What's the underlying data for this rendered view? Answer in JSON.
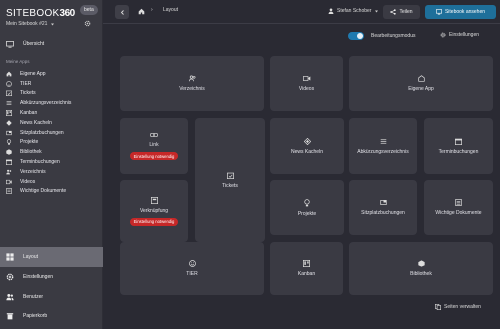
{
  "app": {
    "logo_text": "SITEBOOK",
    "logo_num": "360",
    "beta": "beta",
    "site": "Mein Sitebook #21"
  },
  "sidebar": {
    "overview": "Übersicht",
    "section": "Meine Apps",
    "items": [
      {
        "label": "Eigene App",
        "icon": "home-icon"
      },
      {
        "label": "TIER",
        "icon": "smile-icon"
      },
      {
        "label": "Tickets",
        "icon": "calendar-check-icon"
      },
      {
        "label": "Abkürzungsverzeichnis",
        "icon": "list-icon"
      },
      {
        "label": "Kanban",
        "icon": "kanban-icon"
      },
      {
        "label": "News Kacheln",
        "icon": "diamond-icon"
      },
      {
        "label": "Sitzplatzbuchungen",
        "icon": "seat-icon"
      },
      {
        "label": "Projekte",
        "icon": "bulb-icon"
      },
      {
        "label": "Bibliothek",
        "icon": "library-icon"
      },
      {
        "label": "Terminbuchungen",
        "icon": "calendar-icon"
      },
      {
        "label": "Verzeichnis",
        "icon": "users-icon"
      },
      {
        "label": "Videos",
        "icon": "video-icon"
      },
      {
        "label": "Wichtige Dokumente",
        "icon": "document-icon"
      }
    ],
    "bottom": [
      {
        "label": "Layout",
        "icon": "layout-icon",
        "active": true
      },
      {
        "label": "Einstellungen",
        "icon": "gear-icon"
      },
      {
        "label": "Benutzer",
        "icon": "users-icon"
      },
      {
        "label": "Papierkorb",
        "icon": "trash-icon"
      }
    ]
  },
  "topbar": {
    "breadcrumb": "Layout",
    "user": "Stefan Schober",
    "share": "Teilen",
    "view": "Sitebook ansehen"
  },
  "toolbar": {
    "edit_mode": "Bearbeitungsmodus",
    "settings": "Einstellungen",
    "edit_on": true
  },
  "tiles": {
    "verzeichnis": "Verzeichnis",
    "videos": "Videos",
    "eigene_app": "Eigene App",
    "link": "Link",
    "link_badge": "Einstellung notwendig",
    "tickets": "Tickets",
    "news": "News Kacheln",
    "abk": "Abkürzungsverzeichnis",
    "termin": "Terminbuchungen",
    "verknuepfung": "Verknüpfung",
    "verknuepfung_badge": "Einstellung notwendig",
    "projekte": "Projekte",
    "sitzplatz": "Sitzplatzbuchungen",
    "wichtige": "Wichtige Dokumente",
    "tier": "TIER",
    "kanban": "Kanban",
    "bibliothek": "Bibliothek"
  },
  "footer": {
    "manage_pages": "Seiten verwalten"
  },
  "colors": {
    "accent": "#1e6f9a",
    "danger": "#c62828",
    "bg": "#2a2a33",
    "tile": "#3a3a43",
    "sidebar": "#3a3a42"
  }
}
